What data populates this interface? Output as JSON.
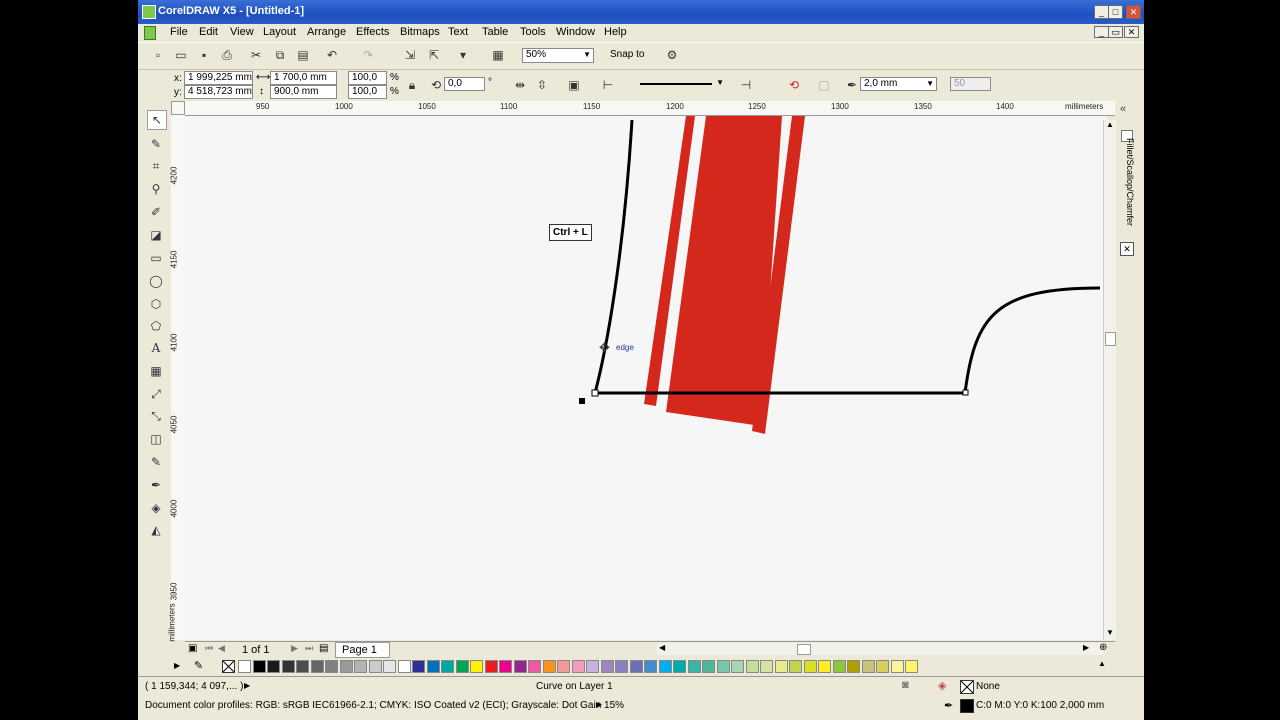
{
  "window": {
    "title": "CorelDRAW X5 - [Untitled-1]",
    "buttons": [
      "_",
      "□",
      "✕"
    ]
  },
  "menu": [
    "File",
    "Edit",
    "View",
    "Layout",
    "Arrange",
    "Effects",
    "Bitmaps",
    "Text",
    "Table",
    "Tools",
    "Window",
    "Help"
  ],
  "toolbar": {
    "zoom": "50%",
    "snap_to": "Snap to"
  },
  "propbar": {
    "x_label": "x:",
    "x": "1 999,225 mm",
    "y_label": "y:",
    "y": "4 518,723 mm",
    "width": "1 700,0 mm",
    "height": "900,0 mm",
    "scale_x": "100,0",
    "scale_y": "100,0",
    "pct": "%",
    "rotation": "0,0",
    "deg": "°",
    "outline_width": "2,0 mm",
    "smoothness": "50"
  },
  "hruler": {
    "labels": [
      "950",
      "1000",
      "1050",
      "1100",
      "1150",
      "1200",
      "1250",
      "1300",
      "1350",
      "1400"
    ],
    "units": "millimeters"
  },
  "vruler": {
    "labels": [
      "4200",
      "4150",
      "4100",
      "4050",
      "4000",
      "3950"
    ],
    "units": "millimeters"
  },
  "canvas": {
    "shortcut_tip": "Ctrl + L",
    "snap_hint": "edge"
  },
  "docker": {
    "title": "Fillet/Scallop/Chamfer"
  },
  "pages": {
    "count": "1 of 1",
    "tab": "Page 1"
  },
  "palette": {
    "colors": [
      "#ffffff",
      "#000000",
      "#1a1a1a",
      "#333333",
      "#4d4d4d",
      "#666666",
      "#808080",
      "#999999",
      "#b3b3b3",
      "#cccccc",
      "#e6e6e6",
      "#ffffff",
      "#2e3192",
      "#0072bc",
      "#00a99d",
      "#00a651",
      "#fff200",
      "#ed1c24",
      "#ec008c",
      "#92278f",
      "#ef5aa2",
      "#f7941d",
      "#f5989d",
      "#f49ac1",
      "#c7b2de",
      "#a186be",
      "#8781bd",
      "#6a71b6",
      "#448ccb",
      "#00aeef",
      "#00aba9",
      "#3bb4a8",
      "#4fb796",
      "#79c7a6",
      "#a8d5b5",
      "#c4df9b",
      "#d7e3a2",
      "#e9ea8a",
      "#c2d64c",
      "#d9e021",
      "#fcee21",
      "#8dc63f",
      "#aba000",
      "#cbc27a",
      "#d6cf5c",
      "#fbf49b",
      "#fff568"
    ]
  },
  "status": {
    "coords": "( 1 159,344; 4 097,... )",
    "object": "Curve on Layer 1",
    "fill": "None",
    "outline": "C:0 M:0 Y:0 K:100  2,000 mm",
    "profiles": "Document color profiles: RGB: sRGB IEC61966-2.1; CMYK: ISO Coated v2 (ECI); Grayscale: Dot Gain 15%"
  },
  "colors": {
    "stripe": "#d4281c",
    "title_gradient": "#1d4fc0"
  }
}
